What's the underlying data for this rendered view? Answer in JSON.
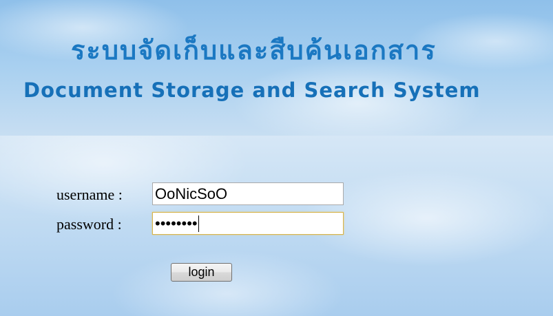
{
  "header": {
    "title_thai": "ระบบจัดเก็บและสืบค้นเอกสาร",
    "title_en": "Document Storage and Search System"
  },
  "form": {
    "username_label": "username :",
    "username_value": "OoNicSoO",
    "password_label": "password :",
    "password_value": "••••••••",
    "login_label": "login"
  },
  "colors": {
    "title": "#1b78c2",
    "sky_top": "#8fc0ea",
    "sky_bottom": "#a9cdee"
  }
}
